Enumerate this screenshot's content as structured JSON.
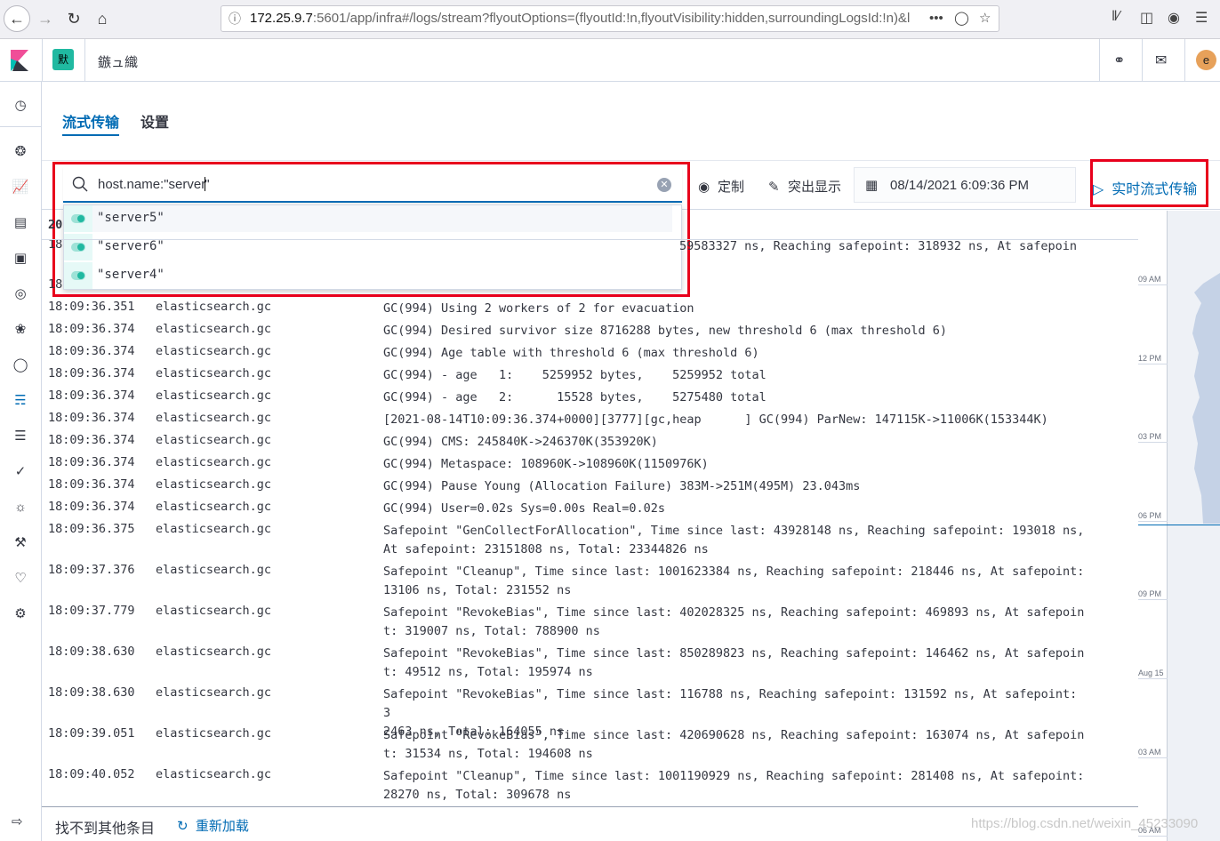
{
  "browser": {
    "url_host": "172.25.9.7",
    "url_rest": ":5601/app/infra#/logs/stream?flyoutOptions=(flyoutId:!n,flyoutVisibility:hidden,surroundingLogsId:!n)&l",
    "more_label": "•••"
  },
  "header": {
    "space_badge": "默",
    "app_title": "鏃ュ織",
    "avatar_letter": "e"
  },
  "tabs": [
    {
      "label": "流式传输",
      "selected": true
    },
    {
      "label": "设置",
      "selected": false
    }
  ],
  "search": {
    "query_before_caret": "host.name:\"server",
    "query_after_caret": "\"",
    "suggestions": [
      "\"server5\"",
      "\"server6\"",
      "\"server4\""
    ]
  },
  "toolbar": {
    "customize_label": "定制",
    "highlight_label": "突出显示",
    "date": "08/14/2021 6:09:36 PM",
    "stream_label": "实时流式传输"
  },
  "log_partial": {
    "first_row_ts_fragment": "18",
    "first_row_msg_fragment": "59583327 ns, Reaching safepoint: 318932 ns, At safepoin",
    "header_fragment": "20",
    "second_row_ts_fragment": "18"
  },
  "logs": [
    {
      "ts": "18:09:36.351",
      "ds": "elasticsearch.gc",
      "msg": "GC(994) Using 2 workers of 2 for evacuation"
    },
    {
      "ts": "18:09:36.374",
      "ds": "elasticsearch.gc",
      "msg": "GC(994) Desired survivor size 8716288 bytes, new threshold 6 (max threshold 6)"
    },
    {
      "ts": "18:09:36.374",
      "ds": "elasticsearch.gc",
      "msg": "GC(994) Age table with threshold 6 (max threshold 6)"
    },
    {
      "ts": "18:09:36.374",
      "ds": "elasticsearch.gc",
      "msg": "GC(994) - age   1:    5259952 bytes,    5259952 total"
    },
    {
      "ts": "18:09:36.374",
      "ds": "elasticsearch.gc",
      "msg": "GC(994) - age   2:      15528 bytes,    5275480 total"
    },
    {
      "ts": "18:09:36.374",
      "ds": "elasticsearch.gc",
      "msg": "[2021-08-14T10:09:36.374+0000][3777][gc,heap      ] GC(994) ParNew: 147115K->11006K(153344K)"
    },
    {
      "ts": "18:09:36.374",
      "ds": "elasticsearch.gc",
      "msg": "GC(994) CMS: 245840K->246370K(353920K)"
    },
    {
      "ts": "18:09:36.374",
      "ds": "elasticsearch.gc",
      "msg": "GC(994) Metaspace: 108960K->108960K(1150976K)"
    },
    {
      "ts": "18:09:36.374",
      "ds": "elasticsearch.gc",
      "msg": "GC(994) Pause Young (Allocation Failure) 383M->251M(495M) 23.043ms"
    },
    {
      "ts": "18:09:36.374",
      "ds": "elasticsearch.gc",
      "msg": "GC(994) User=0.02s Sys=0.00s Real=0.02s"
    },
    {
      "ts": "18:09:36.375",
      "ds": "elasticsearch.gc",
      "msg": "Safepoint \"GenCollectForAllocation\", Time since last: 43928148 ns, Reaching safepoint: 193018 ns,\nAt safepoint: 23151808 ns, Total: 23344826 ns"
    },
    {
      "ts": "18:09:37.376",
      "ds": "elasticsearch.gc",
      "msg": "Safepoint \"Cleanup\", Time since last: 1001623384 ns, Reaching safepoint: 218446 ns, At safepoint:\n13106 ns, Total: 231552 ns"
    },
    {
      "ts": "18:09:37.779",
      "ds": "elasticsearch.gc",
      "msg": "Safepoint \"RevokeBias\", Time since last: 402028325 ns, Reaching safepoint: 469893 ns, At safepoin\nt: 319007 ns, Total: 788900 ns"
    },
    {
      "ts": "18:09:38.630",
      "ds": "elasticsearch.gc",
      "msg": "Safepoint \"RevokeBias\", Time since last: 850289823 ns, Reaching safepoint: 146462 ns, At safepoin\nt: 49512 ns, Total: 195974 ns"
    },
    {
      "ts": "18:09:38.630",
      "ds": "elasticsearch.gc",
      "msg": "Safepoint \"RevokeBias\", Time since last: 116788 ns, Reaching safepoint: 131592 ns, At safepoint: 3\n2463 ns, Total: 164055 ns"
    },
    {
      "ts": "18:09:39.051",
      "ds": "elasticsearch.gc",
      "msg": "Safepoint \"RevokeBias\", Time since last: 420690628 ns, Reaching safepoint: 163074 ns, At safepoin\nt: 31534 ns, Total: 194608 ns"
    },
    {
      "ts": "18:09:40.052",
      "ds": "elasticsearch.gc",
      "msg": "Safepoint \"Cleanup\", Time since last: 1001190929 ns, Reaching safepoint: 281408 ns, At safepoint:\n28270 ns, Total: 309678 ns"
    }
  ],
  "minimap": {
    "ticks": [
      "09 AM",
      "12 PM",
      "03 PM",
      "06 PM",
      "09 PM",
      "Aug 15",
      "03 AM",
      "06 AM"
    ]
  },
  "footer": {
    "no_more": "找不到其他条目",
    "reload": "重新加载"
  },
  "watermark": "https://blog.csdn.net/weixin_45233090",
  "colors": {
    "accent": "#006bb4",
    "highlight_box": "#e8001c",
    "space_badge": "#20b9a1",
    "avatar": "#e7a15a"
  },
  "icons": [
    "back-icon",
    "forward-icon",
    "reload-icon",
    "home-icon",
    "search-icon",
    "clear-icon",
    "eye-icon",
    "highlighter-icon",
    "calendar-icon",
    "play-icon",
    "refresh-icon"
  ]
}
